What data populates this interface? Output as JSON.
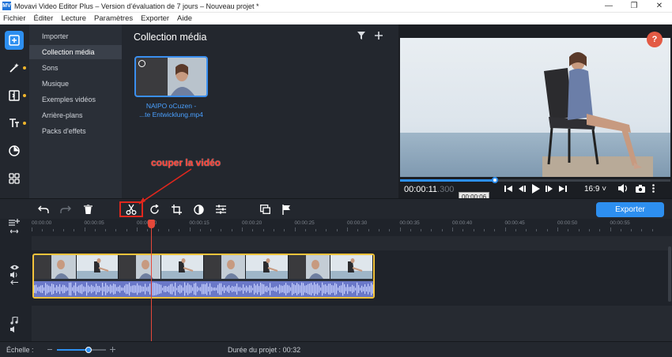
{
  "window": {
    "title": "Movavi Video Editor Plus – Version d’évaluation de 7 jours – Nouveau projet *",
    "logo_text": "MV",
    "min_glyph": "—",
    "max_glyph": "❐",
    "close_glyph": "✕"
  },
  "menu": [
    "Fichier",
    "Éditer",
    "Lecture",
    "Paramètres",
    "Exporter",
    "Aide"
  ],
  "rail": [
    {
      "icon": "import-icon",
      "active": true
    },
    {
      "icon": "magic-wand-icon",
      "active": false,
      "dot": true
    },
    {
      "icon": "transitions-icon",
      "active": false,
      "dot": true
    },
    {
      "icon": "titles-icon",
      "active": false,
      "dot": true
    },
    {
      "icon": "stickers-icon",
      "active": false
    },
    {
      "icon": "more-tools-icon",
      "active": false
    }
  ],
  "categories": [
    "Importer",
    "Collection média",
    "Sons",
    "Musique",
    "Exemples vidéos",
    "Arrière-plans",
    "Packs d'effets"
  ],
  "active_category_index": 1,
  "media": {
    "title": "Collection média",
    "item": {
      "caption_line1": "NAIPO oCuzen -",
      "caption_line2": "...te Entwicklung.mp4"
    }
  },
  "player": {
    "help": "?",
    "time_main": "00:00:11",
    "time_ms": ".300",
    "tooltip": "00:00:06",
    "aspect_ratio": "16:9 ˅",
    "progress": 0.35
  },
  "toolbar": {
    "export_label": "Exporter"
  },
  "timeline": {
    "ruler": [
      "00:00:00",
      "00:00:05",
      "00:00:10",
      "00:00:15",
      "00:00:20",
      "00:00:25",
      "00:00:30",
      "00:00:35",
      "00:00:40",
      "00:00:45",
      "00:00:50",
      "00:00:55"
    ]
  },
  "status": {
    "scale_label": "Échelle :",
    "duration_label": "Durée du projet :",
    "duration_value": "00:32",
    "zoom": 0.65
  },
  "annotation": {
    "text": "couper la vidéo"
  },
  "colors": {
    "accent": "#2d8ff0",
    "highlight": "#e0271d",
    "clip_border": "#f2c33b",
    "help": "#e35a44"
  }
}
